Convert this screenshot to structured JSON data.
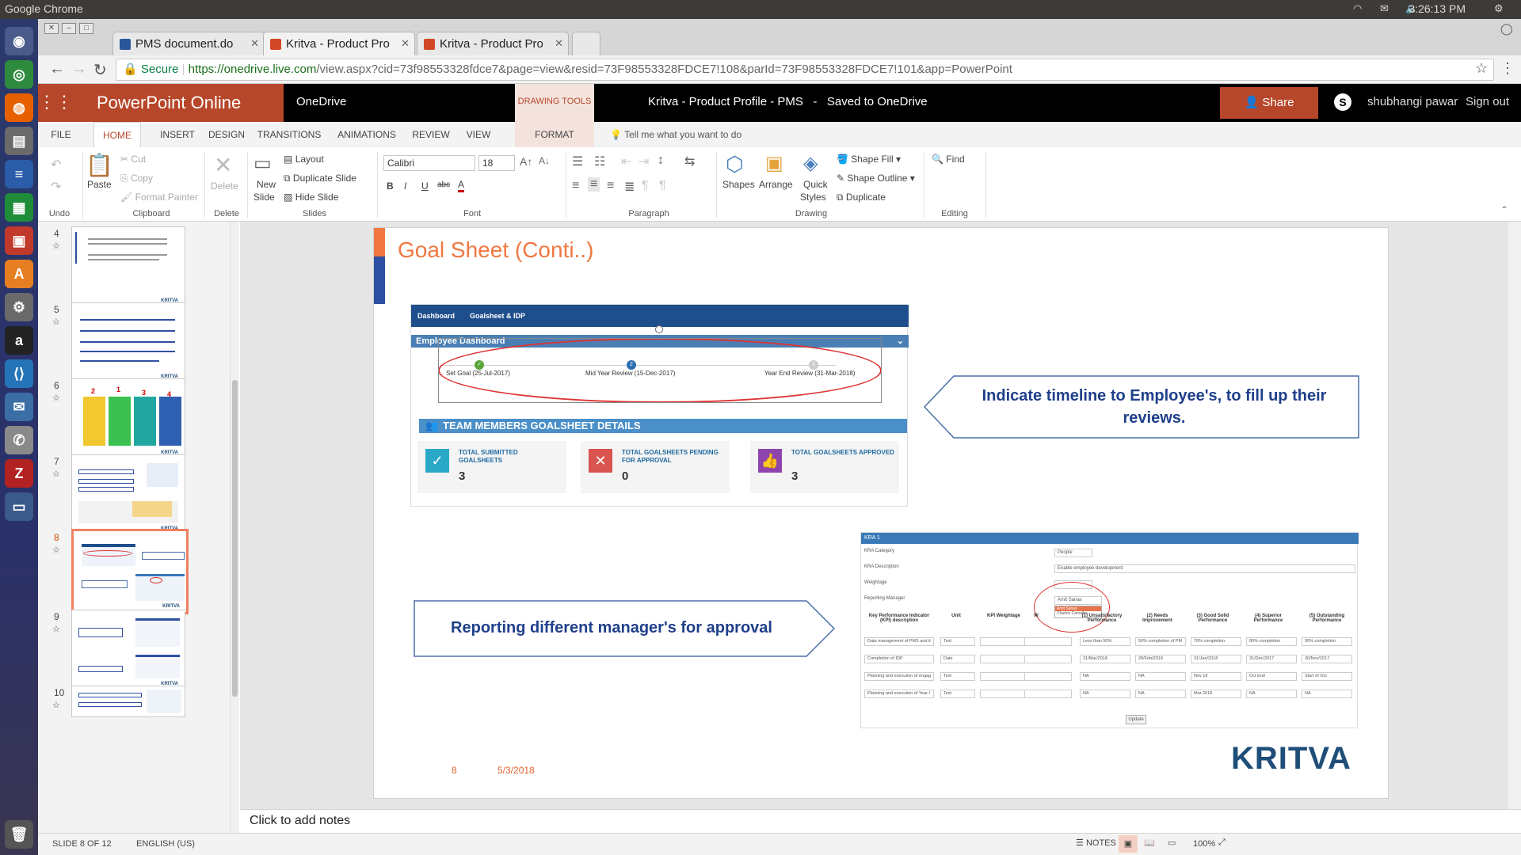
{
  "os": {
    "app_name": "Google Chrome",
    "clock": "3:26:13 PM"
  },
  "browser": {
    "tabs": [
      {
        "title": "PMS document.do",
        "favicon_color": "#2b579a"
      },
      {
        "title": "Kritva - Product Pro",
        "favicon_color": "#d24726"
      },
      {
        "title": "Kritva - Product Pro",
        "favicon_color": "#d24726"
      }
    ],
    "secure_label": "Secure",
    "url_host": "https://onedrive.live.com",
    "url_path": "/view.aspx?cid=73f98553328fdce7&page=view&resid=73F98553328FDCE7!108&parId=73F98553328FDCE7!101&app=PowerPoint"
  },
  "header": {
    "app_name": "PowerPoint Online",
    "location": "OneDrive",
    "context_tab": "DRAWING TOOLS",
    "doc_title": "Kritva - Product Profile - PMS",
    "separator": "-",
    "save_status": "Saved to OneDrive",
    "share_label": "Share",
    "user": "shubhangi pawar",
    "sign_out": "Sign out"
  },
  "ribbon_tabs": [
    "FILE",
    "HOME",
    "INSERT",
    "DESIGN",
    "TRANSITIONS",
    "ANIMATIONS",
    "REVIEW",
    "VIEW",
    "FORMAT"
  ],
  "tell_me": "Tell me what you want to do",
  "ribbon": {
    "undo_group": "Undo",
    "paste": "Paste",
    "cut": "Cut",
    "copy": "Copy",
    "format_painter": "Format Painter",
    "clipboard_group": "Clipboard",
    "delete": "Delete",
    "delete_group": "Delete",
    "new_slide_1": "New",
    "new_slide_2": "Slide",
    "layout": "Layout",
    "duplicate_slide": "Duplicate Slide",
    "hide_slide": "Hide Slide",
    "slides_group": "Slides",
    "font_name": "Calibri",
    "font_size": "18",
    "font_group": "Font",
    "bold": "B",
    "italic": "I",
    "underline": "U",
    "strike": "abc",
    "font_color": "A",
    "paragraph_group": "Paragraph",
    "shapes": "Shapes",
    "arrange": "Arrange",
    "quick_styles_1": "Quick",
    "quick_styles_2": "Styles",
    "shape_fill": "Shape Fill",
    "shape_outline": "Shape Outline",
    "duplicate": "Duplicate",
    "drawing_group": "Drawing",
    "find": "Find",
    "editing_group": "Editing"
  },
  "thumbnails": [
    {
      "num": "4"
    },
    {
      "num": "5"
    },
    {
      "num": "6"
    },
    {
      "num": "7"
    },
    {
      "num": "8"
    },
    {
      "num": "9"
    },
    {
      "num": "10"
    }
  ],
  "thumb_text": {
    "t6_numbers": [
      "2",
      "1",
      "3",
      "4"
    ]
  },
  "slide": {
    "title": "Goal Sheet (Conti..)",
    "callout_timeline": "Indicate timeline to Employee's, to fill up their reviews.",
    "callout_manager": "Reporting different manager's for approval",
    "page_number": "8",
    "date": "5/3/2018",
    "logo": "KRITVA"
  },
  "dashboard": {
    "nav_items": [
      "Dashboard",
      "Goalsheet & IDP"
    ],
    "panel_title": "Employee Dashboard",
    "milestones": [
      {
        "label": "Set Goal (25-Jul-2017)",
        "marker": "✓",
        "color": "#5aa63a"
      },
      {
        "label": "Mid Year Review (15-Dec-2017)",
        "marker": "2",
        "color": "#2a6cb0"
      },
      {
        "label": "Year End Review (31-Mar-2018)",
        "marker": "3",
        "color": "#cccccc"
      }
    ],
    "section_title": "TEAM MEMBERS GOALSHEET DETAILS",
    "cards": [
      {
        "label": "TOTAL SUBMITTED GOALSHEETS",
        "value": "3",
        "icon": "✓",
        "color": "#2aa8c8"
      },
      {
        "label": "TOTAL GOALSHEETS PENDING FOR APPROVAL",
        "value": "0",
        "icon": "✕",
        "color": "#d9534f"
      },
      {
        "label": "TOTAL GOALSHEETS APPROVED",
        "value": "3",
        "icon": "👍",
        "color": "#8e44ad"
      }
    ]
  },
  "kra": {
    "header": "KRA 1",
    "fields": [
      {
        "label": "KRA Category",
        "value": "People"
      },
      {
        "label": "KRA Description",
        "value": "Enable employee development"
      },
      {
        "label": "Weightage",
        "value": ""
      },
      {
        "label": "Reporting Manager",
        "value": "Amit Sanas"
      }
    ],
    "dropdown_options": [
      "Amit Sanas",
      "Charles Carvalho"
    ],
    "columns": [
      "Key Performance Indicator (KPI) description",
      "Unit",
      "KPI Weightage",
      "W",
      "(1) Unsatisfactory Performance",
      "(2) Needs Improvement",
      "(3) Good Solid Performance",
      "(4) Superior Performance",
      "(5) Outstanding Performance"
    ],
    "rows": [
      [
        "Data management of PMS and it",
        "Text",
        "",
        "",
        "Less than 50%",
        "50% completion of PM",
        "70% completion",
        "80% completion",
        "95% completion"
      ],
      [
        "Completion of IDP",
        "Date",
        "",
        "",
        "31/Mar/2018",
        "28/Feb/2018",
        "31/Jan/2018",
        "31/Dec/2017",
        "30/Nov/2017"
      ],
      [
        "Planning and execution of engag",
        "Text",
        "",
        "",
        "NA",
        "NA",
        "Nov 18",
        "Oct End",
        "Start of Oct"
      ],
      [
        "Planning and execution of Year I",
        "Text",
        "",
        "",
        "NA",
        "NA",
        "Mar 2018",
        "NA",
        "NA"
      ]
    ],
    "update_label": "Update"
  },
  "notes_placeholder": "Click to add notes",
  "status": {
    "slide_info": "SLIDE 8 OF 12",
    "language": "ENGLISH (US)",
    "notes": "NOTES",
    "zoom": "100%"
  }
}
